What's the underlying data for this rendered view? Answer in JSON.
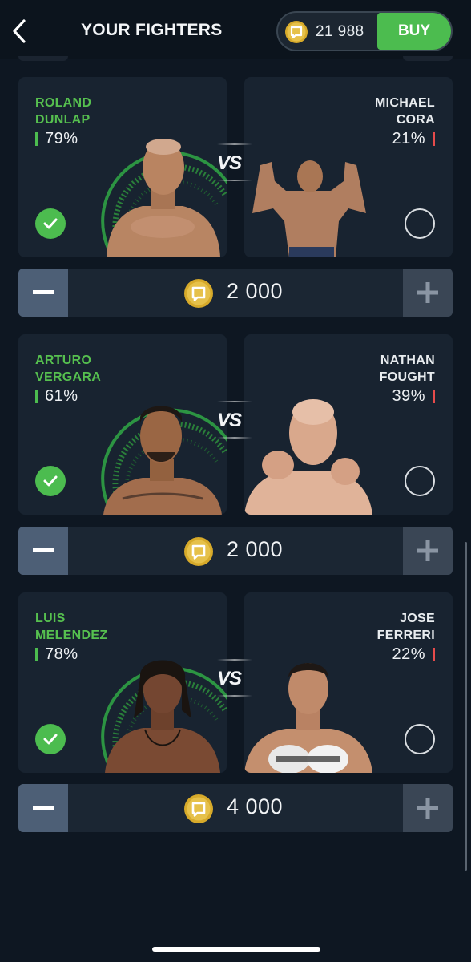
{
  "header": {
    "title": "YOUR FIGHTERS",
    "balance": "21 988",
    "buy_label": "BUY",
    "icons": {
      "back": "chevron-left-icon",
      "coin": "coin-icon"
    }
  },
  "vs_label": "VS",
  "matchups": [
    {
      "left": {
        "first": "ROLAND",
        "last": "DUNLAP",
        "percent": "79%",
        "selected": true
      },
      "right": {
        "first": "MICHAEL",
        "last": "CORA",
        "percent": "21%",
        "selected": false
      },
      "stake": "2 000"
    },
    {
      "left": {
        "first": "ARTURO",
        "last": "VERGARA",
        "percent": "61%",
        "selected": true
      },
      "right": {
        "first": "NATHAN",
        "last": "FOUGHT",
        "percent": "39%",
        "selected": false
      },
      "stake": "2 000"
    },
    {
      "left": {
        "first": "LUIS",
        "last": "MELENDEZ",
        "percent": "78%",
        "selected": true
      },
      "right": {
        "first": "JOSE",
        "last": "FERRERI",
        "percent": "22%",
        "selected": false
      },
      "stake": "4 000"
    }
  ],
  "colors": {
    "background": "#0e1722",
    "card": "#182330",
    "accent_green": "#4cbc4f",
    "accent_red": "#e64b4b",
    "coin_gold": "#d7aa2a"
  }
}
